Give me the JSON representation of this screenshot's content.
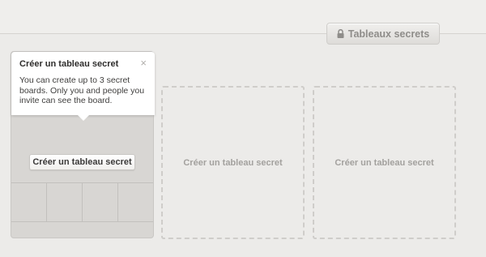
{
  "header": {
    "secret_boards_label": "Tableaux secrets",
    "secret_boards_icon": "lock-icon"
  },
  "board_card": {
    "create_label": "Créer un tableau secret",
    "tooltip": {
      "title": "Créer un tableau secret",
      "body": "You can create up to 3 secret boards. Only you and people you invite can see the board.",
      "close_glyph": "×"
    }
  },
  "placeholders": [
    {
      "label": "Créer un tableau secret"
    },
    {
      "label": "Créer un tableau secret"
    }
  ]
}
